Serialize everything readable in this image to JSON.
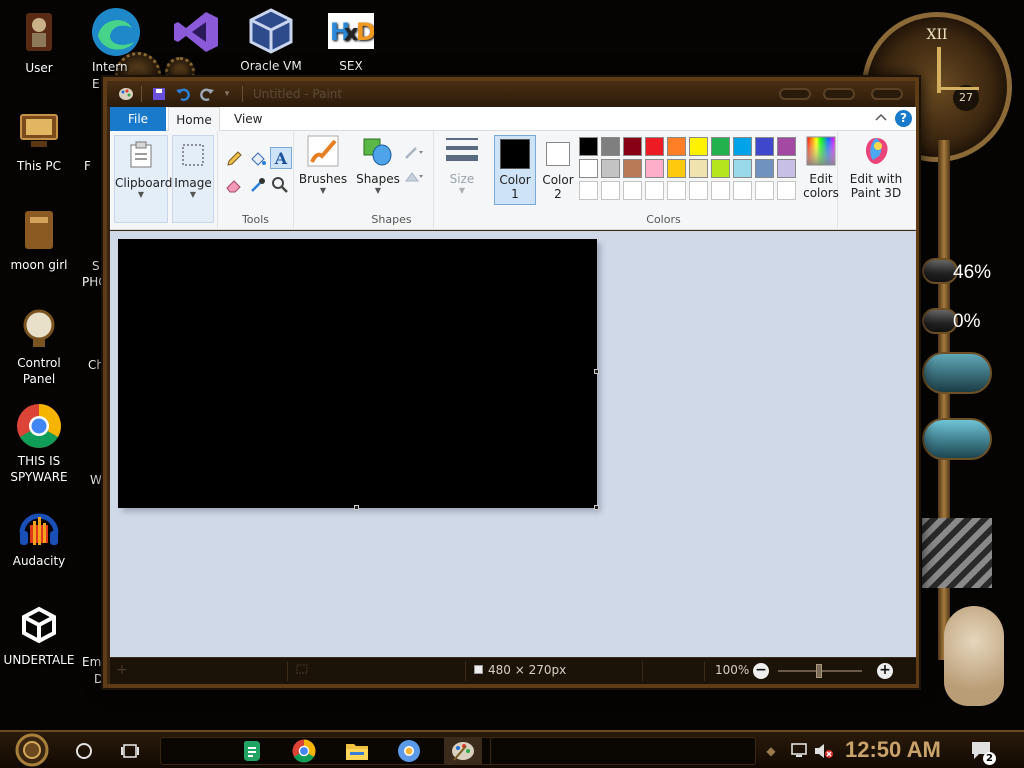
{
  "desktop": {
    "icons": [
      {
        "label": "User",
        "name": "user"
      },
      {
        "label": "This PC",
        "name": "this-pc"
      },
      {
        "label": "moon girl",
        "name": "moon-girl"
      },
      {
        "label": "Control Panel",
        "name": "control-panel"
      },
      {
        "label": "THIS IS SPYWARE",
        "name": "chrome-spyware"
      },
      {
        "label": "Audacity",
        "name": "audacity"
      },
      {
        "label": "UNDERTALE",
        "name": "undertale"
      },
      {
        "label": "Oracle VM",
        "name": "oracle-vm"
      },
      {
        "label": "SEX",
        "name": "sex"
      }
    ],
    "partial_labels": {
      "internet": "Intern",
      "internet2": "E",
      "f": "F",
      "s": "S",
      "phc": "PHC",
      "ch": "Ch",
      "w": "W",
      "emb": "Emb",
      "d": "D"
    },
    "widgets": {
      "clock_numeral": "XII",
      "clock_date": "27",
      "gauge1": "46%",
      "gauge2": "0%"
    }
  },
  "paint": {
    "title": "Untitled - Paint",
    "tabs": {
      "file": "File",
      "home": "Home",
      "view": "View"
    },
    "help": "?",
    "ribbon": {
      "clipboard": "Clipboard",
      "image": "Image",
      "tools_label": "Tools",
      "brushes": "Brushes",
      "shapes": "Shapes",
      "shapes_label": "Shapes",
      "size": "Size",
      "color1": "Color\n1",
      "color1_a": "Color",
      "color1_b": "1",
      "color2_a": "Color",
      "color2_b": "2",
      "colors_label": "Colors",
      "edit_colors_a": "Edit",
      "edit_colors_b": "colors",
      "paint3d_a": "Edit with",
      "paint3d_b": "Paint 3D"
    },
    "palette_row1": [
      "#000000",
      "#7f7f7f",
      "#880015",
      "#ed1c24",
      "#ff7f27",
      "#fff200",
      "#22b14c",
      "#00a2e8",
      "#3f48cc",
      "#a349a4"
    ],
    "palette_row2": [
      "#ffffff",
      "#c3c3c3",
      "#b97a57",
      "#ffaec9",
      "#ffc90e",
      "#efe4b0",
      "#b5e61d",
      "#99d9ea",
      "#7092be",
      "#c8bfe7"
    ],
    "color1_value": "#000000",
    "color2_value": "#ffffff",
    "status": {
      "dimensions": "480 × 270px",
      "zoom": "100%"
    }
  },
  "taskbar": {
    "clock": "12:50 AM",
    "notifications": "2"
  }
}
